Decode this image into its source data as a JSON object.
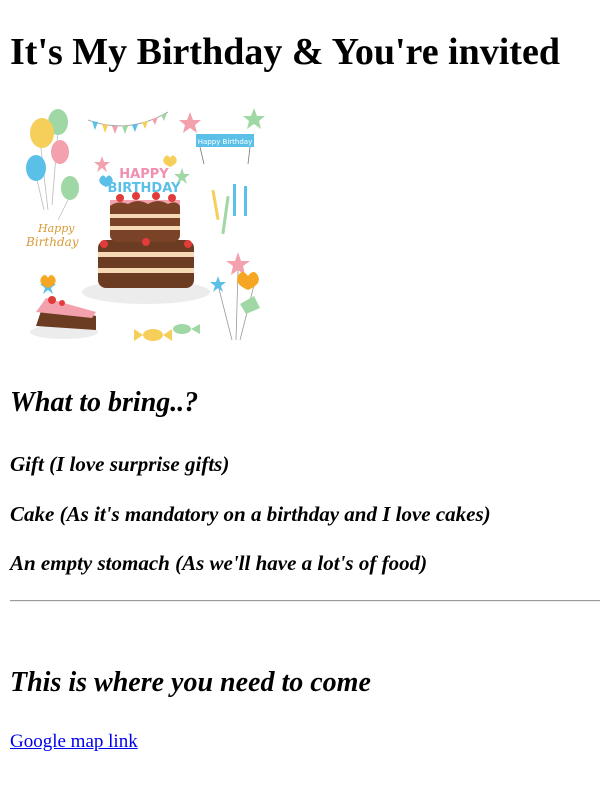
{
  "header": {
    "title": "It's My Birthday & You're invited"
  },
  "illustration": {
    "banner_text": "Happy Birthday",
    "cake_text_top": "HAPPY",
    "cake_text_bottom": "BIRTHDAY",
    "script_text_1": "Happy",
    "script_text_2": "Birthday"
  },
  "bring": {
    "heading": "What to bring..?",
    "items": [
      "Gift (I love surprise gifts)",
      "Cake (As it's mandatory on a birthday and I love cakes)",
      "An empty stomach (As we'll have a lot's of food)"
    ]
  },
  "location": {
    "heading": "This is where you need to come",
    "link_text": "Google map link"
  }
}
